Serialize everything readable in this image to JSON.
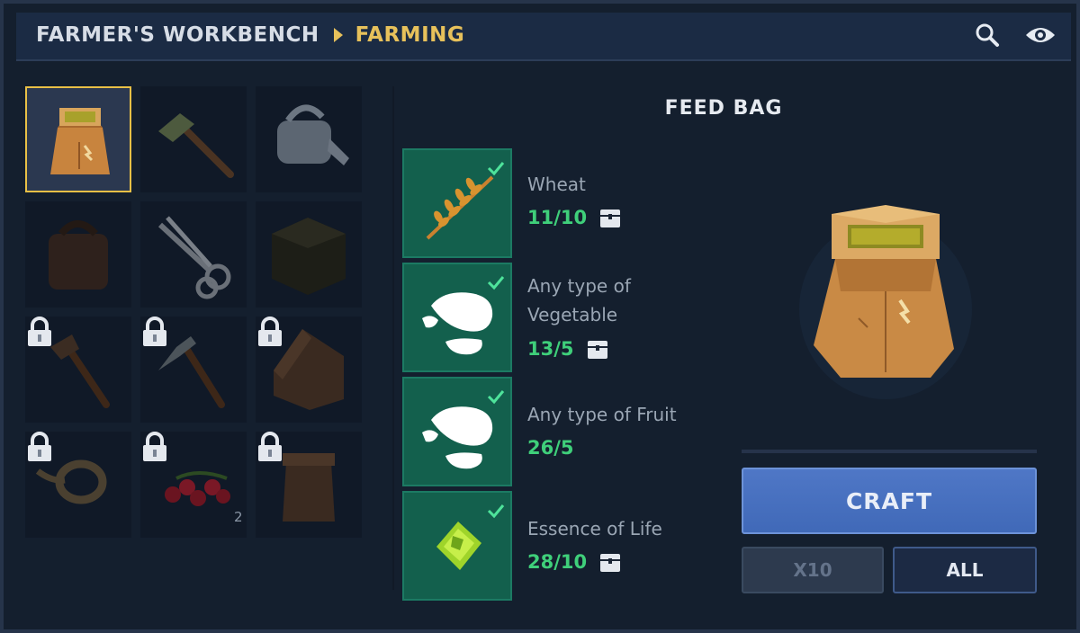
{
  "header": {
    "title": "FARMER'S WORKBENCH",
    "subtitle": "FARMING",
    "icons": [
      "search-icon",
      "eye-icon"
    ]
  },
  "recipes": {
    "items": [
      {
        "name": "feed-bag",
        "selected": true,
        "locked": false
      },
      {
        "name": "hoe",
        "selected": false,
        "locked": false
      },
      {
        "name": "watering-can",
        "selected": false,
        "locked": false
      },
      {
        "name": "backpack",
        "selected": false,
        "locked": false
      },
      {
        "name": "shears",
        "selected": false,
        "locked": false
      },
      {
        "name": "crate",
        "selected": false,
        "locked": false
      },
      {
        "name": "axe",
        "selected": false,
        "locked": true
      },
      {
        "name": "pickaxe",
        "selected": false,
        "locked": true
      },
      {
        "name": "doghouse",
        "selected": false,
        "locked": true
      },
      {
        "name": "rope",
        "selected": false,
        "locked": true
      },
      {
        "name": "berries",
        "selected": false,
        "locked": true,
        "badge": "2"
      },
      {
        "name": "basket",
        "selected": false,
        "locked": true
      }
    ]
  },
  "recipe": {
    "title": "FEED BAG",
    "ingredients": [
      {
        "icon": "wheat-icon",
        "name": "Wheat",
        "count": "11/10"
      },
      {
        "icon": "vegetable-icon",
        "name": "Any type of Vegetable",
        "line1": "Any type of",
        "line2": "Vegetable",
        "count": "13/5"
      },
      {
        "icon": "fruit-icon",
        "name": "Any type of Fruit",
        "count": "26/5"
      },
      {
        "icon": "essence-icon",
        "name": "Essence of Life",
        "count": "28/10"
      }
    ]
  },
  "actions": {
    "craft": "CRAFT",
    "x10": "X10",
    "all": "ALL"
  },
  "colors": {
    "accent_gold": "#e7c15b",
    "ok_green": "#3fcf7a",
    "craft_blue": "#4a71c0",
    "tile_green": "#13604d"
  }
}
